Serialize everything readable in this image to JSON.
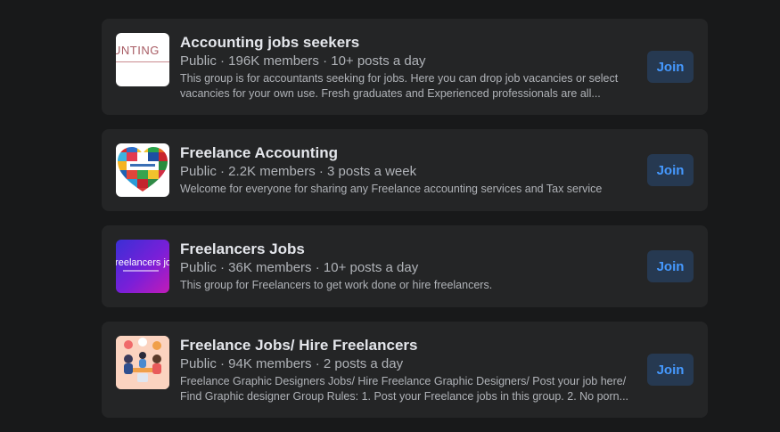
{
  "groups": [
    {
      "name": "Accounting jobs seekers",
      "meta": "Public · 196K members · 10+ posts a day",
      "description": "This group is for accountants seeking for jobs. Here you can drop job vacancies or select vacancies for your own use. Fresh graduates and Experienced professionals are all...",
      "thumb_text": "UNTING",
      "join_label": "Join"
    },
    {
      "name": "Freelance Accounting",
      "meta": "Public · 2.2K members · 3 posts a week",
      "description": "Welcome for everyone for sharing any Freelance accounting services and Tax service",
      "join_label": "Join"
    },
    {
      "name": "Freelancers Jobs",
      "meta": "Public · 36K members · 10+ posts a day",
      "description": "This group for Freelancers to get work done or hire freelancers.",
      "thumb_text": "freelancers job",
      "join_label": "Join"
    },
    {
      "name": "Freelance Jobs/ Hire Freelancers",
      "meta": "Public · 94K members · 2 posts a day",
      "description": "Freelance Graphic Designers Jobs/ Hire Freelance Graphic Designers/ Post your job here/ Find Graphic designer Group Rules: 1. Post your Freelance jobs in this group. 2. No porn...",
      "join_label": "Join"
    }
  ],
  "colors": {
    "page_bg": "#18191a",
    "card_bg": "#242526",
    "title": "#e4e6eb",
    "secondary_text": "#b0b3b8",
    "join_bg": "#263951",
    "join_text": "#4599ff"
  }
}
